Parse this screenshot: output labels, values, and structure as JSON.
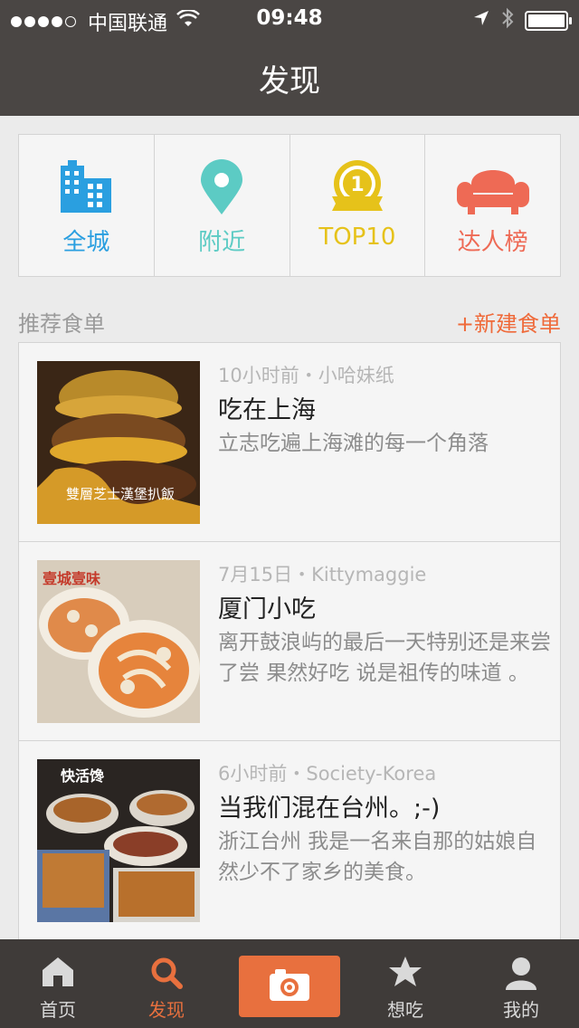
{
  "status_bar": {
    "carrier": "中国联通",
    "time": "09:48"
  },
  "header": {
    "title": "发现"
  },
  "categories": [
    {
      "label": "全城",
      "icon": "building-icon",
      "color": "#2a9fe0"
    },
    {
      "label": "附近",
      "icon": "location-pin-icon",
      "color": "#5ccbc4"
    },
    {
      "label": "TOP10",
      "icon": "top10-medal-icon",
      "color": "#e6c21a"
    },
    {
      "label": "达人榜",
      "icon": "sofa-icon",
      "color": "#ee6a55"
    }
  ],
  "section": {
    "title": "推荐食单",
    "new_label": "+新建食单"
  },
  "recommendations": [
    {
      "meta": "10小时前・小哈妹纸",
      "title": "吃在上海",
      "desc": "立志吃遍上海滩的每一个角落",
      "image_text": "雙層芝士漢堡扒飯"
    },
    {
      "meta": "7月15日・Kittymaggie",
      "title": "厦门小吃",
      "desc": "离开鼓浪屿的最后一天特别还是来尝了尝 果然好吃 说是祖传的味道 。",
      "image_text": "壹城壹味"
    },
    {
      "meta": "6小时前・Society-Korea",
      "title": "当我们混在台州。;-)",
      "desc": "浙江台州 我是一名来自那的姑娘自然少不了家乡的美食。",
      "image_text": "快活馋"
    }
  ],
  "tabbar": {
    "home": "首页",
    "discover": "发现",
    "camera": "camera-icon",
    "want": "想吃",
    "mine": "我的",
    "accent": "#e8703e"
  }
}
